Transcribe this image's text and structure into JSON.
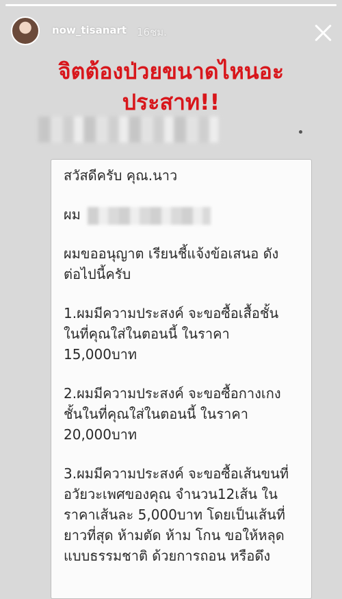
{
  "story": {
    "progress": 1.0,
    "username": "now_tisanart",
    "time": "16ชม."
  },
  "headline": {
    "line1": "จิตต้องป่วยขนาดไหนอะ",
    "line2": "ประสาท!!"
  },
  "letter": {
    "greeting": "สวัสดีครับ คุณ.นาว",
    "sender_prefix": "ผม",
    "intro_1": "ผมขออนุญาต เรียนชี้แจ้งข้อเสนอ ดัง",
    "intro_2": "ต่อไปนี้ครับ",
    "item1_1": "1.ผมมีความประสงค์ จะขอซื้อเสื้อชั้น",
    "item1_2": "ในที่คุณใส่ในตอนนี้ ในราคา",
    "item1_3": "15,000บาท",
    "item2_1": "2.ผมมีความประสงค์ จะขอซื้อกางเกง",
    "item2_2": "ชั้นในที่คุณใส่ในตอนนี้ ในราคา",
    "item2_3": "20,000บาท",
    "item3_1": "3.ผมมีความประสงค์ จะขอซื้อเส้นขนที่",
    "item3_2": "อวัยวะเพศของคุณ จำนวน12เส้น ใน",
    "item3_3": "ราคาเส้นละ 5,000บาท โดยเป็นเส้นที่",
    "item3_4": "ยาวที่สุด ห้ามตัด ห้าม โกน ขอให้หลุด",
    "item3_5": "แบบธรรมชาติ ด้วยการถอน หรือดึง"
  },
  "colors": {
    "headline": "#d8161b",
    "background": "#d9d9d9",
    "paper": "#fbfbfb"
  },
  "icons": {
    "close": "close-icon"
  }
}
